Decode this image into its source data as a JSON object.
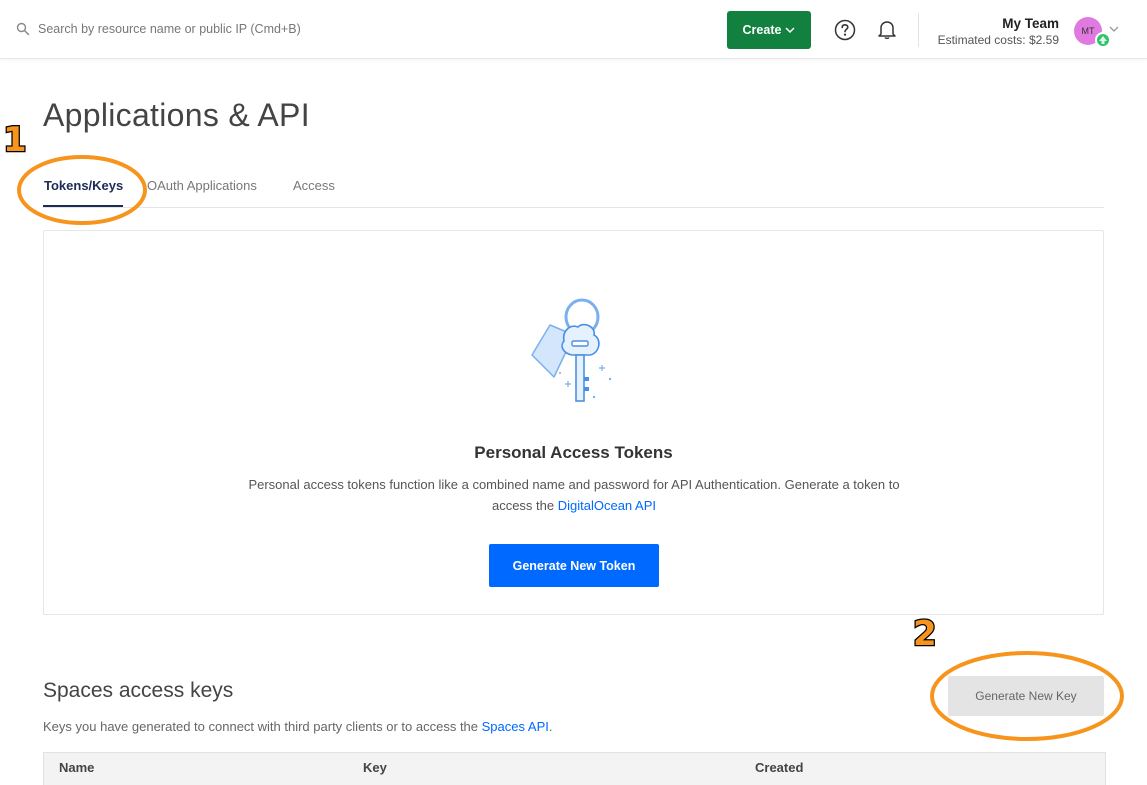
{
  "topbar": {
    "search_placeholder": "Search by resource name or public IP (Cmd+B)",
    "create_label": "Create",
    "team_name": "My Team",
    "estimated_costs": "Estimated costs: $2.59",
    "avatar_initials": "MT"
  },
  "page": {
    "title": "Applications & API",
    "tabs": [
      {
        "label": "Tokens/Keys",
        "active": true
      },
      {
        "label": "OAuth Applications",
        "active": false
      },
      {
        "label": "Access",
        "active": false
      }
    ]
  },
  "tokens_card": {
    "title": "Personal Access Tokens",
    "description": "Personal access tokens function like a combined name and password for API Authentication. Generate a token to access the ",
    "link_text": "DigitalOcean API",
    "button_label": "Generate New Token"
  },
  "spaces": {
    "title": "Spaces access keys",
    "description": "Keys you have generated to connect with third party clients or to access the ",
    "link_text": "Spaces API",
    "description_end": ".",
    "button_label": "Generate New Key",
    "columns": [
      "Name",
      "Key",
      "Created"
    ]
  },
  "annotations": {
    "step1": "1",
    "step2": "2",
    "color": "#f7941d"
  },
  "colors": {
    "create_green": "#12803e",
    "primary_blue": "#0069ff",
    "tab_active": "#1d2b57"
  }
}
